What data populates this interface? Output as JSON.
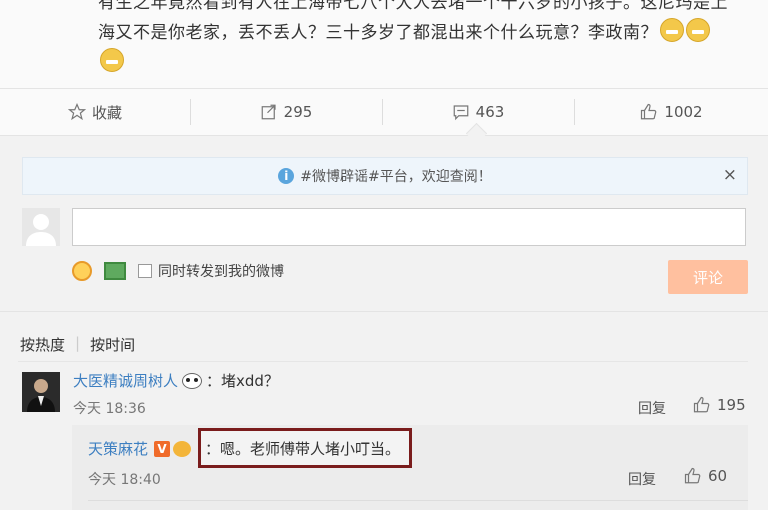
{
  "post": {
    "line1": "有生之年竟然看到有人在上海带七八个大人去堵一个十六岁的小孩子。这尼玛是上",
    "line2": "海又不是你老家，丢不丢人？三十多岁了都混出来个什么玩意？李政南？"
  },
  "actions": {
    "favorite_label": "收藏",
    "repost_count": "295",
    "comment_count": "463",
    "like_count": "1002"
  },
  "notice": {
    "text": "#微博辟谣#平台，欢迎查阅！",
    "close": "×"
  },
  "composer": {
    "input_value": "",
    "also_repost_label": "同时转发到我的微博",
    "submit_label": "评论"
  },
  "sort": {
    "by_hot": "按热度",
    "by_time": "按时间"
  },
  "comments": [
    {
      "user": "大医精诚周树人",
      "text": "：堵xdd？",
      "time": "今天 18:36",
      "reply_label": "回复",
      "likes": "195"
    }
  ],
  "reply": {
    "user": "天策麻花",
    "badge": "V",
    "text": "：嗯。老师傅带人堵小叮当。",
    "time": "今天 18:40",
    "reply_label": "回复",
    "likes": "60"
  },
  "colors": {
    "link": "#3d7fc1",
    "submit_bg": "#ffc09f",
    "highlight_border": "#7a1c1c",
    "info_blue": "#5aa5dd"
  }
}
